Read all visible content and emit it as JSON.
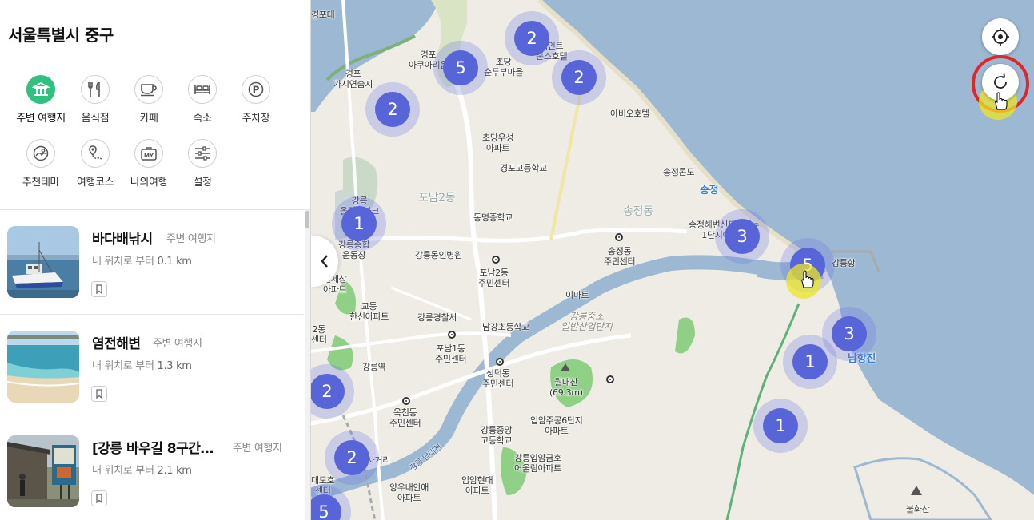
{
  "panel": {
    "location_title": "서울특별시 중구",
    "categories": [
      {
        "label": "주변 여행지",
        "icon": "landmark-icon",
        "active": true
      },
      {
        "label": "음식점",
        "icon": "fork-knife-icon"
      },
      {
        "label": "카페",
        "icon": "coffee-cup-icon"
      },
      {
        "label": "숙소",
        "icon": "bed-icon"
      },
      {
        "label": "주차장",
        "icon": "parking-icon"
      },
      {
        "label": "추천테마",
        "icon": "theme-icon"
      },
      {
        "label": "여행코스",
        "icon": "route-icon"
      },
      {
        "label": "나의여행",
        "icon": "my-bag-icon"
      },
      {
        "label": "설정",
        "icon": "sliders-icon"
      }
    ],
    "places": [
      {
        "name": "바다배낚시",
        "category": "주변 여행지",
        "distance_prefix": "내 위치로 부터",
        "distance": "0.1 km"
      },
      {
        "name": "염전해변",
        "category": "주변 여행지",
        "distance_prefix": "내 위치로 부터",
        "distance": "1.3 km"
      },
      {
        "name": "[강릉 바우길 8구간…",
        "category": "주변 여행지",
        "distance_prefix": "내 위치로 부터",
        "distance": "2.1 km"
      }
    ]
  },
  "map": {
    "clusters": [
      "2",
      "5",
      "2",
      "2",
      "1",
      "3",
      "5",
      "3",
      "1",
      "1",
      "2",
      "2",
      "5"
    ],
    "labels": {
      "gyeongpodae": "경포대",
      "gyeongpo_gasi": "경포\n가시연습지",
      "gyeongpo_aqua": "경포\n아쿠아리움",
      "chodang_tofu": "초당\n순두부마을",
      "st_johns": "세인트\n존스호텔",
      "abio_hotel": "아비오호텔",
      "chodang_apt": "초당우성\n아파트",
      "gyeongpo_high": "경포고등학교",
      "songjeong_kondo": "송정콘도",
      "songjeong": "송정",
      "ponam2dong": "포남2동",
      "songjeongdong_area": "송정동",
      "gangneung_park": "강릉\n올림픽파크",
      "dongmyeong_middle": "동명중학교",
      "songjeong_haebyeon": "송정해변신도브래뉴\n1단지아파트",
      "gangneung_stadium": "강릉종합\n운동장",
      "gangneung_hospital": "강릉동인병원",
      "songjeongdong_center": "송정동\n주민센터",
      "gangneung_port": "강릉항",
      "ponam2_center": "포남2동\n주민센터",
      "emart": "이마트",
      "sinsegye": "신세상\n아파트",
      "gyodong": "교동\n한신아파트",
      "police": "강릉경찰서",
      "namgang_elem": "남강초등학교",
      "industrial": "강릉중소\n일반산업단지",
      "ponam1_center": "포남1동\n주민센터",
      "gyodong_center": "2동\n센터",
      "gangneung_station": "강릉역",
      "seongdeok_center": "성덕동\n주민센터",
      "woldaesan": "월대산\n(69.3m)",
      "namhangjin": "남항진",
      "okcheon_center": "옥천동\n주민센터",
      "ibam_apt": "입암주공6단지\n아파트",
      "jungang_high": "강릉중앙\n고등학교",
      "eoullim_apt": "강릉입암금호\n어울림아파트",
      "ibam_hyundai": "입암현대\n아파트",
      "yangu": "양우내안애\n아파트",
      "daedoho": "대도호\n센터",
      "crossroad": "임당사거리",
      "bulhwasan": "불화산",
      "gangneung_namdaecheon": "강릉 남대천"
    }
  },
  "colors": {
    "accent_green": "#2ec27e",
    "cluster_blue": "#5865d8",
    "sea": "#9cb8d2",
    "land": "#eeece4",
    "highlight_yellow": "#ebe628",
    "annotation_red": "#e02727"
  }
}
